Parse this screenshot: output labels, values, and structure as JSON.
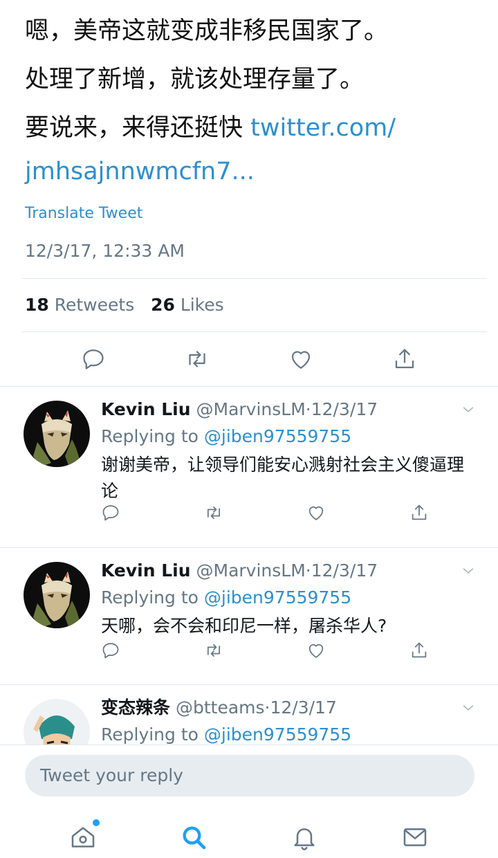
{
  "tweet": {
    "line1": "嗯，美帝这就变成非移民国家了。",
    "line2": "处理了新增，就该处理存量了。",
    "line3_text": "要说来，来得还挺快 ",
    "line3_link": "twitter.com/",
    "line4_link": "jmhsajnnwmcfn7...",
    "translate_label": "Translate Tweet",
    "timestamp": "12/3/17, 12:33 AM",
    "retweets_count": "18",
    "retweets_label": "Retweets",
    "likes_count": "26",
    "likes_label": "Likes"
  },
  "replies": [
    {
      "name": "Kevin Liu",
      "handle": "@MarvinsLM",
      "dot": "·",
      "date": "12/3/17",
      "replying_prefix": "Replying to ",
      "replying_handle": "@jiben97559755",
      "text": "谢谢美帝，让领导们能安心溅射社会主义傻逼理论"
    },
    {
      "name": "Kevin Liu",
      "handle": "@MarvinsLM",
      "dot": "·",
      "date": "12/3/17",
      "replying_prefix": "Replying to ",
      "replying_handle": "@jiben97559755",
      "text": "天哪，会不会和印尼一样，屠杀华人?"
    },
    {
      "name": "变态辣条",
      "handle": "@btteams",
      "dot": "·",
      "date": "12/3/17",
      "replying_prefix": "Replying to ",
      "replying_handle": "@jiben97559755",
      "text": ""
    }
  ],
  "compose": {
    "placeholder": "Tweet your reply"
  },
  "icons": {
    "reply": "reply-icon",
    "retweet": "retweet-icon",
    "like": "heart-icon",
    "share": "share-icon",
    "home": "home-icon",
    "search": "search-icon",
    "notifications": "bell-icon",
    "messages": "mail-icon"
  },
  "colors": {
    "accent": "#1da1f2",
    "link": "#2b8fd0",
    "muted": "#657786"
  }
}
